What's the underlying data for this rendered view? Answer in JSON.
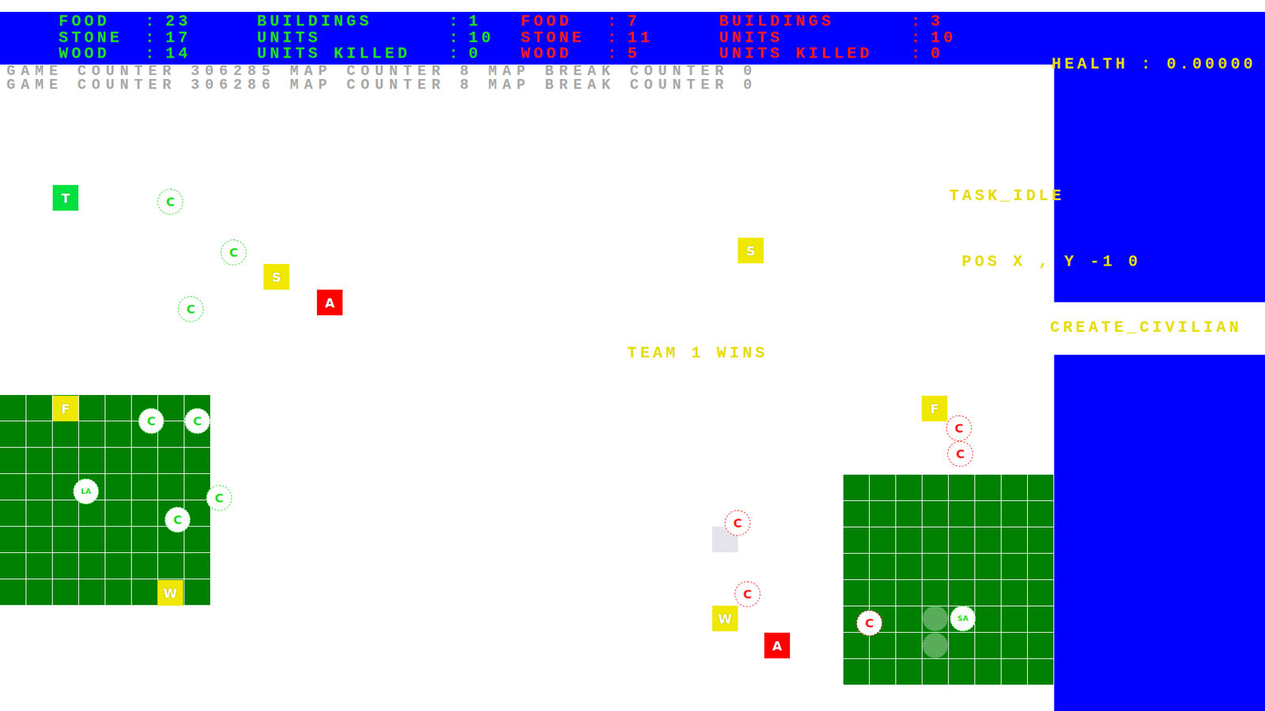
{
  "separator": ":",
  "teams": [
    {
      "color": "#22dd22",
      "resources": [
        {
          "label": "FOOD",
          "value": "23"
        },
        {
          "label": "STONE",
          "value": "17"
        },
        {
          "label": "WOOD",
          "value": "14"
        }
      ],
      "stats": [
        {
          "label": "BUILDINGS",
          "value": "1"
        },
        {
          "label": "UNITS",
          "value": "10"
        },
        {
          "label": "UNITS KILLED",
          "value": "0"
        }
      ]
    },
    {
      "color": "#ff1a1a",
      "resources": [
        {
          "label": "FOOD",
          "value": "7"
        },
        {
          "label": "STONE",
          "value": "11"
        },
        {
          "label": "WOOD",
          "value": "5"
        }
      ],
      "stats": [
        {
          "label": "BUILDINGS",
          "value": "3"
        },
        {
          "label": "UNITS",
          "value": "10"
        },
        {
          "label": "UNITS KILLED",
          "value": "0"
        }
      ]
    }
  ],
  "counters": [
    "GAME COUNTER 306285 MAP COUNTER 8 MAP BREAK COUNTER 0",
    "GAME COUNTER 306286 MAP COUNTER 8 MAP BREAK COUNTER 0"
  ],
  "banner": "TEAM 1 WINS",
  "panel": {
    "health": "HEALTH : 0.00000",
    "task": "TASK_IDLE",
    "position": "POS X , Y -1 0",
    "action": "CREATE_CIVILIAN"
  },
  "map": {
    "entities": [
      {
        "kind": "building",
        "label": "T",
        "color": "#00e040",
        "faded": false
      },
      {
        "kind": "building",
        "label": "S",
        "color": "#f0e800",
        "faded": false
      },
      {
        "kind": "building",
        "label": "A",
        "color": "#ff0000",
        "faded": false
      },
      {
        "kind": "building",
        "label": "S",
        "color": "#f0e800",
        "faded": false
      },
      {
        "kind": "building",
        "label": "F",
        "color": "#f0e800",
        "faded": false
      },
      {
        "kind": "building",
        "label": "W",
        "color": "#f0e800",
        "faded": false
      },
      {
        "kind": "building",
        "label": "F",
        "color": "#f0e800",
        "faded": false
      },
      {
        "kind": "building",
        "label": "W",
        "color": "#f0e800",
        "faded": false
      },
      {
        "kind": "building",
        "label": "A",
        "color": "#ff0000",
        "faded": false
      },
      {
        "kind": "unit",
        "label": "C",
        "color": "#22dd22",
        "faded": false
      },
      {
        "kind": "unit",
        "label": "C",
        "color": "#22dd22",
        "faded": false
      },
      {
        "kind": "unit",
        "label": "C",
        "color": "#22dd22",
        "faded": false
      },
      {
        "kind": "unit",
        "label": "C",
        "color": "#22dd22",
        "faded": false
      },
      {
        "kind": "unit",
        "label": "C",
        "color": "#22dd22",
        "faded": false
      },
      {
        "kind": "unit",
        "label": "LA",
        "color": "#22dd22",
        "faded": false
      },
      {
        "kind": "unit",
        "label": "C",
        "color": "#22dd22",
        "faded": false
      },
      {
        "kind": "unit",
        "label": "C",
        "color": "#22dd22",
        "faded": false
      },
      {
        "kind": "unit",
        "label": "C",
        "color": "#ff1a1a",
        "faded": false
      },
      {
        "kind": "unit",
        "label": "C",
        "color": "#ff1a1a",
        "faded": false
      },
      {
        "kind": "unit",
        "label": "C",
        "color": "#ff1a1a",
        "faded": false
      },
      {
        "kind": "unit",
        "label": "C",
        "color": "#ff1a1a",
        "faded": false
      },
      {
        "kind": "unit",
        "label": "C",
        "color": "#ff1a1a",
        "faded": false
      },
      {
        "kind": "unit",
        "label": "",
        "color": "#22dd22",
        "faded": true
      },
      {
        "kind": "unit",
        "label": "SA",
        "color": "#22dd22",
        "faded": false
      },
      {
        "kind": "unit",
        "label": "",
        "color": "#22dd22",
        "faded": true
      }
    ]
  }
}
